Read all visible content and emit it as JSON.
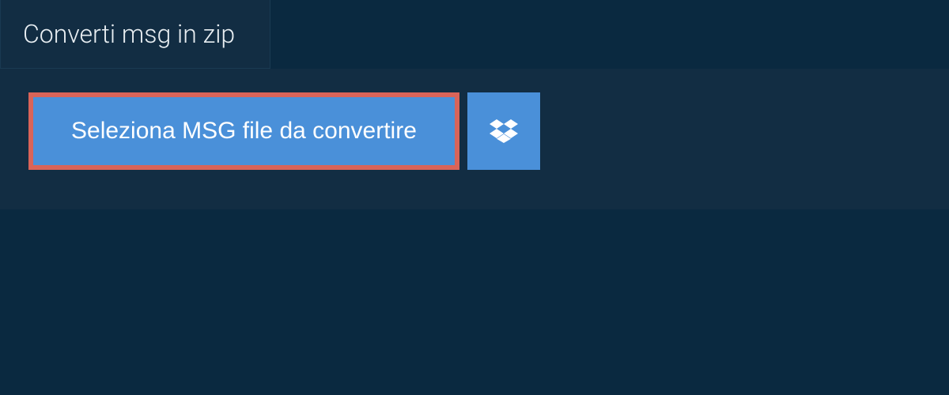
{
  "tab": {
    "label": "Converti msg in zip"
  },
  "actions": {
    "select_file_label": "Seleziona MSG file da convertire"
  }
}
